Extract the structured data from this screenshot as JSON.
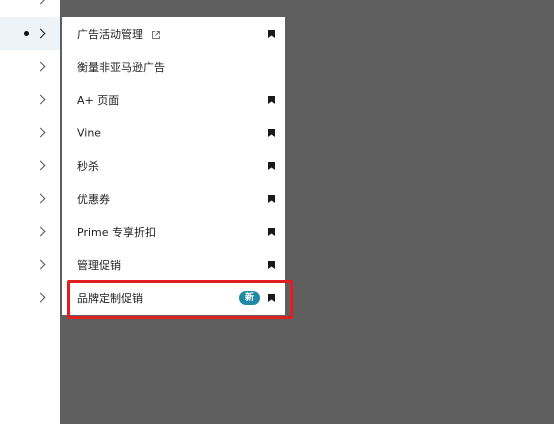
{
  "menu": {
    "items": [
      {
        "label": "广告活动管理",
        "external": true,
        "bookmarked": true,
        "badge": ""
      },
      {
        "label": "衡量非亚马逊广告",
        "external": false,
        "bookmarked": false,
        "badge": ""
      },
      {
        "label": "A+ 页面",
        "external": false,
        "bookmarked": true,
        "badge": ""
      },
      {
        "label": "Vine",
        "external": false,
        "bookmarked": true,
        "badge": ""
      },
      {
        "label": "秒杀",
        "external": false,
        "bookmarked": true,
        "badge": ""
      },
      {
        "label": "优惠券",
        "external": false,
        "bookmarked": true,
        "badge": ""
      },
      {
        "label": "Prime 专享折扣",
        "external": false,
        "bookmarked": true,
        "badge": ""
      },
      {
        "label": "管理促销",
        "external": false,
        "bookmarked": true,
        "badge": ""
      },
      {
        "label": "品牌定制促销",
        "external": false,
        "bookmarked": true,
        "badge": "新"
      }
    ]
  },
  "colors": {
    "overlay": "#5f5f5f",
    "badge": "#1f8aa3",
    "highlight": "#e02020",
    "bookmark": "#1a1a1a"
  },
  "icons": {
    "external": "external-link-icon",
    "bookmark": "bookmark-icon",
    "chevron": "chevron-right-icon"
  }
}
